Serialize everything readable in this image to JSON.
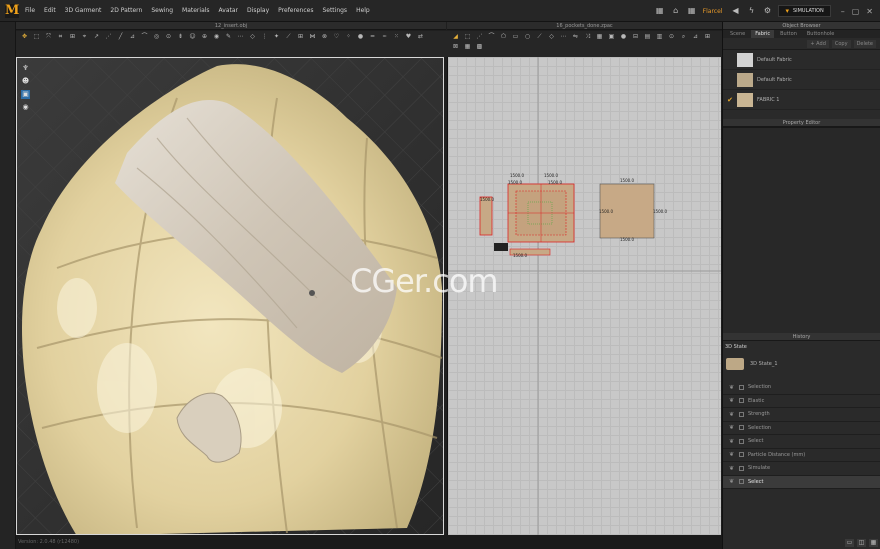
{
  "menu": {
    "logo": "M",
    "items": [
      "File",
      "Edit",
      "3D Garment",
      "2D Pattern",
      "Sewing",
      "Materials",
      "Avatar",
      "Display",
      "Preferences",
      "Settings",
      "Help"
    ],
    "user": "Flarcel",
    "simulation_label": "SIMULATION"
  },
  "windows": {
    "left_title": "12_insert.obj",
    "mid_title": "16_pockets_done.zpac"
  },
  "watermark": "CGer.com",
  "pattern": {
    "labels": {
      "t1": "1500.0",
      "t2": "1500.0",
      "t3": "1500.0",
      "t4": "1500.0",
      "t5": "1500.0",
      "t6": "1500.0",
      "t7": "1500.0",
      "t8": "1500.0",
      "t9": "1500.0",
      "t10": "1500.0"
    }
  },
  "object_browser": {
    "title": "Object Browser",
    "tabs": [
      "Scene",
      "Fabric",
      "Button",
      "Buttonhole"
    ],
    "active_tab": "Fabric",
    "buttons": {
      "add": "+ Add",
      "copy": "Copy",
      "delete": "Delete"
    },
    "fabrics": [
      {
        "name": "Default Fabric",
        "color": "#d3d3d3",
        "checked": ""
      },
      {
        "name": "Default Fabric",
        "color": "#bba98a",
        "checked": ""
      },
      {
        "name": "FABRIC 1",
        "color": "#c9b593",
        "checked": "✔"
      }
    ]
  },
  "property_editor": {
    "title": "Property Editor"
  },
  "history": {
    "title": "History",
    "state_header": "3D State",
    "state_name": "3D State_1",
    "items": [
      {
        "label": "Selection",
        "active": false
      },
      {
        "label": "Elastic",
        "active": false
      },
      {
        "label": "Strength",
        "active": false
      },
      {
        "label": "Selection",
        "active": false
      },
      {
        "label": "Select",
        "active": false
      },
      {
        "label": "Particle Distance (mm)",
        "active": false
      },
      {
        "label": "Simulate",
        "active": false
      },
      {
        "label": "Select",
        "active": true
      }
    ]
  },
  "status": {
    "version": "Version: 2.0.48 (r12480)"
  },
  "colors": {
    "accent": "#f0a21b",
    "pillow": "#e6d7a6",
    "fabric_overlay": "#ddd4c6"
  }
}
